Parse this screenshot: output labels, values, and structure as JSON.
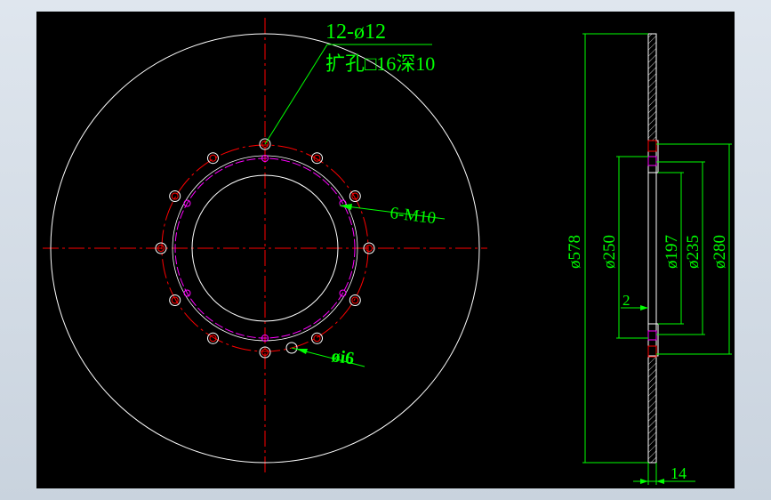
{
  "colors": {
    "background": "#000000",
    "outline": "#ffffff",
    "centerline": "#ff0000",
    "dimension": "#00ff00",
    "pitch_circle": "#ff00ff",
    "window_frame": "#d3dbe4"
  },
  "front_view": {
    "hole_callout_line1": "12-ø12",
    "hole_callout_line2": "扩孔□16深10",
    "tapped_callout": "6-M10",
    "pin_callout": "øi6"
  },
  "side_view": {
    "dim_outer": "ø578",
    "dim_250": "ø250",
    "dim_197": "ø197",
    "dim_235": "ø235",
    "dim_280": "ø280",
    "dim_step": "2",
    "dim_thickness": "14"
  },
  "icons": [
    "crosshair-centerline"
  ]
}
